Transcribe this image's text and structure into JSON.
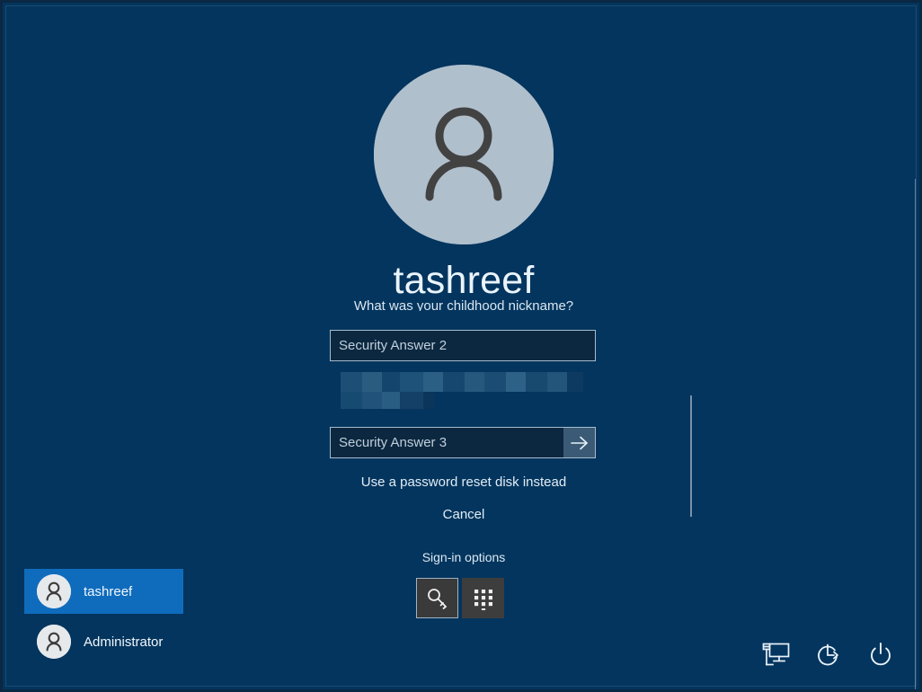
{
  "screen": {
    "kind": "windows-lock-screen-password-reset",
    "background_color": "#03355e",
    "accent_color": "#0f6cbd"
  },
  "account": {
    "display_name": "tashreef",
    "avatar_icon": "user-silhouette-icon"
  },
  "security_questions": {
    "visible_question_label": "What was your childhood nickname?",
    "censored_question_label": "",
    "fields": [
      {
        "name": "security-answer-2",
        "placeholder": "Security Answer 2",
        "value": "",
        "has_submit": false
      },
      {
        "name": "security-answer-3",
        "placeholder": "Security Answer 3",
        "value": "",
        "has_submit": true,
        "submit_icon": "arrow-right-icon"
      }
    ]
  },
  "links": {
    "password_reset_disk": "Use a password reset disk instead",
    "cancel": "Cancel"
  },
  "signin_options": {
    "label": "Sign-in options",
    "buttons": [
      {
        "name": "password-key-option",
        "icon": "key-icon",
        "selected": true
      },
      {
        "name": "pin-option",
        "icon": "pin-keypad-icon",
        "selected": false
      }
    ]
  },
  "user_list": {
    "users": [
      {
        "name": "tashreef",
        "selected": true,
        "avatar_icon": "user-silhouette-icon"
      },
      {
        "name": "Administrator",
        "selected": false,
        "avatar_icon": "user-silhouette-icon"
      }
    ]
  },
  "system_icons": [
    {
      "name": "network-icon",
      "label": "Network"
    },
    {
      "name": "ease-of-access-icon",
      "label": "Ease of Access"
    },
    {
      "name": "power-icon",
      "label": "Power"
    }
  ]
}
